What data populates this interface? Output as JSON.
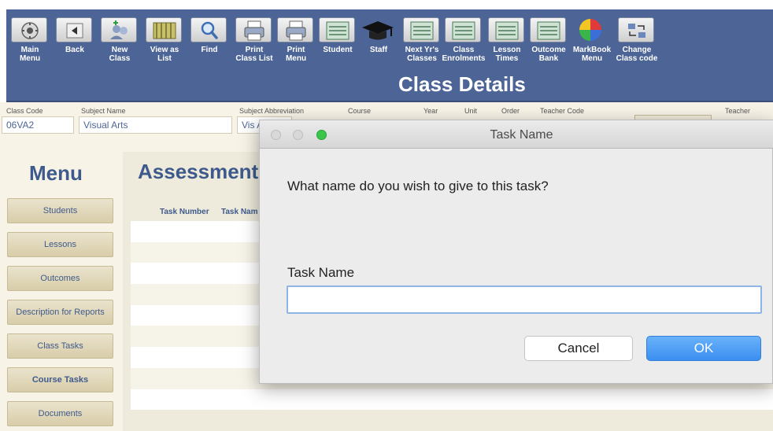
{
  "toolbar": {
    "title": "Class Details",
    "buttons": [
      {
        "label": "Main\nMenu",
        "icon": "main-menu-icon"
      },
      {
        "label": "Back",
        "icon": "back-arrow-icon"
      },
      {
        "label": "New\nClass",
        "icon": "new-class-icon"
      },
      {
        "label": "View as\nList",
        "icon": "list-view-icon"
      },
      {
        "label": "Find",
        "icon": "magnifier-icon"
      },
      {
        "label": "Print\nClass List",
        "icon": "printer-icon"
      },
      {
        "label": "Print\nMenu",
        "icon": "printer-icon"
      },
      {
        "label": "Student",
        "icon": "ledger-icon"
      },
      {
        "label": "Staff",
        "icon": "mortarboard-icon"
      },
      {
        "label": "Next Yr's\nClasses",
        "icon": "ledger-icon"
      },
      {
        "label": "Class\nEnrolments",
        "icon": "ledger-icon"
      },
      {
        "label": "Lesson\nTimes",
        "icon": "ledger-icon"
      },
      {
        "label": "Outcome\nBank",
        "icon": "ledger-icon"
      },
      {
        "label": "MarkBook\nMenu",
        "icon": "pie-chart-icon"
      },
      {
        "label": "Change\nClass code",
        "icon": "swap-icon"
      }
    ]
  },
  "fields": {
    "class_code_label": "Class Code",
    "class_code_value": "06VA2",
    "subject_name_label": "Subject Name",
    "subject_name_value": "Visual Arts",
    "subject_abbrev_label": "Subject Abbreviation",
    "subject_abbrev_value": "Vis A",
    "course_label": "Course",
    "year_label": "Year",
    "unit_label": "Unit",
    "order_label": "Order",
    "teacher_code_label": "Teacher Code",
    "teacher_label": "Teacher"
  },
  "menu": {
    "title": "Menu",
    "items": [
      "Students",
      "Lessons",
      "Outcomes",
      "Description for Reports",
      "Class Tasks",
      "Course Tasks",
      "Documents"
    ]
  },
  "assessment": {
    "title": "Assessment",
    "col_task_number": "Task Number",
    "col_task_name": "Task Nam"
  },
  "dialog": {
    "title": "Task Name",
    "question": "What name do you wish to give to this task?",
    "field_label": "Task Name",
    "field_value": "",
    "cancel_label": "Cancel",
    "ok_label": "OK"
  }
}
